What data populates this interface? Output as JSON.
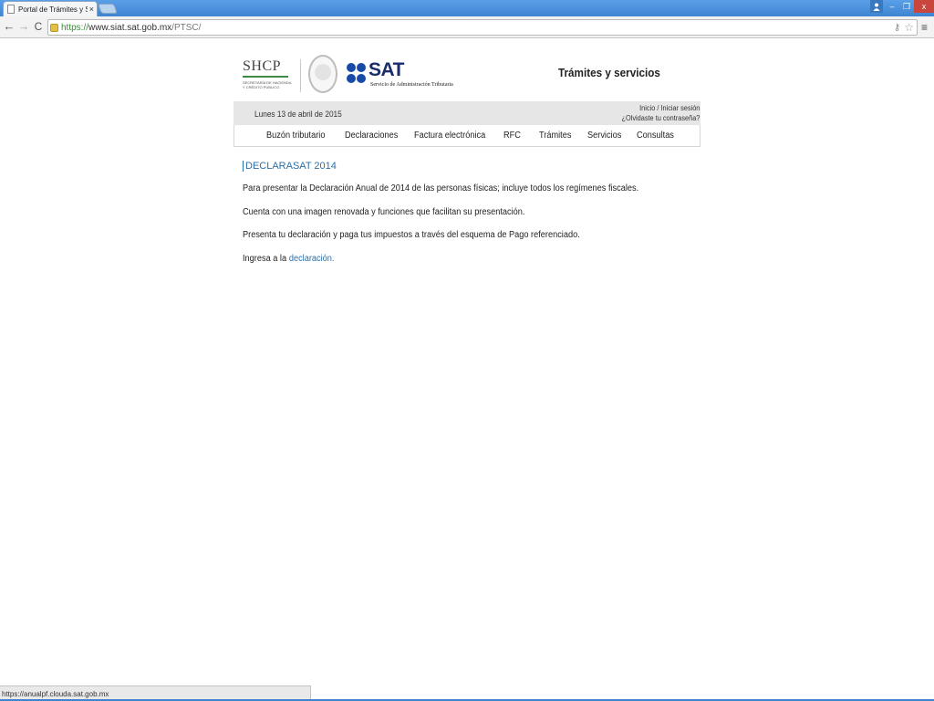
{
  "browser": {
    "tab_title": "Portal de Trámites y Servi",
    "tab_close": "×",
    "url_prefix": "https://",
    "url_host": "www.siat.sat.gob.mx",
    "url_path": "/PTSC/",
    "status_url": "https://anualpf.clouda.sat.gob.mx",
    "icons": {
      "back": "←",
      "forward": "→",
      "reload": "C",
      "key": "⚷",
      "star": "☆",
      "menu": "≡",
      "minimize": "–",
      "maximize": "❐",
      "close": "x",
      "user": "👤"
    }
  },
  "header": {
    "shcp": "SHCP",
    "shcp_sub_1": "SECRETARÍA DE HACIENDA",
    "shcp_sub_2": "Y CRÉDITO PÚBLICO",
    "sat": "SAT",
    "sat_sub": "Servicio de Administración Tributaria",
    "title": "Trámites y servicios"
  },
  "greybar": {
    "date": "Lunes 13 de abril de 2015",
    "login": "Inicio / Iniciar sesión",
    "forgot": "¿Olvidaste tu contraseña?"
  },
  "nav": {
    "items": [
      "Buzón tributario",
      "Declaraciones",
      "Factura electrónica",
      "RFC",
      "Trámites",
      "Servicios",
      "Consultas"
    ]
  },
  "content": {
    "title": "DECLARASAT 2014",
    "p1": "Para presentar la Declaración Anual de 2014 de las personas físicas; incluye todos los regímenes fiscales.",
    "p2": "Cuenta con una imagen renovada y funciones que facilitan su presentación.",
    "p3": "Presenta tu declaración y paga tus impuestos a través del esquema de Pago referenciado.",
    "p4_text": "Ingresa a la",
    "p4_link": "declaración."
  },
  "colors": {
    "link": "#2b6fa8",
    "sat_blue": "#1a4aa8",
    "chrome_blue": "#3f84d0",
    "grey_bar": "#e6e6e6"
  }
}
